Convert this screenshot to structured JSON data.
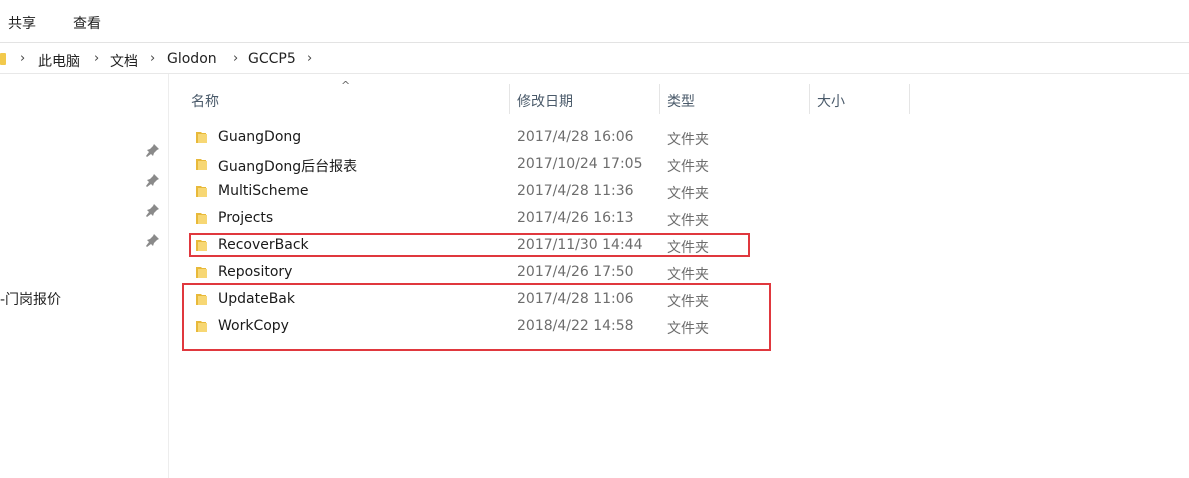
{
  "ribbon": {
    "tabs": [
      "共享",
      "查看"
    ]
  },
  "address": {
    "crumbs": [
      "此电脑",
      "文档",
      "Glodon",
      "GCCP5"
    ]
  },
  "nav": {
    "label": "-门岗报价"
  },
  "columns": {
    "name": "名称",
    "modified": "修改日期",
    "type": "类型",
    "size": "大小"
  },
  "files": [
    {
      "name": "GuangDong",
      "modified": "2017/4/28 16:06",
      "type": "文件夹"
    },
    {
      "name": "GuangDong后台报表",
      "modified": "2017/10/24 17:05",
      "type": "文件夹"
    },
    {
      "name": "MultiScheme",
      "modified": "2017/4/28 11:36",
      "type": "文件夹"
    },
    {
      "name": "Projects",
      "modified": "2017/4/26 16:13",
      "type": "文件夹"
    },
    {
      "name": "RecoverBack",
      "modified": "2017/11/30 14:44",
      "type": "文件夹"
    },
    {
      "name": "Repository",
      "modified": "2017/4/26 17:50",
      "type": "文件夹"
    },
    {
      "name": "UpdateBak",
      "modified": "2017/4/28 11:06",
      "type": "文件夹"
    },
    {
      "name": "WorkCopy",
      "modified": "2018/4/22 14:58",
      "type": "文件夹"
    }
  ],
  "colors": {
    "highlight": "#e0383e",
    "folder": "#f2c94c",
    "header_text": "#4a5a6a"
  }
}
